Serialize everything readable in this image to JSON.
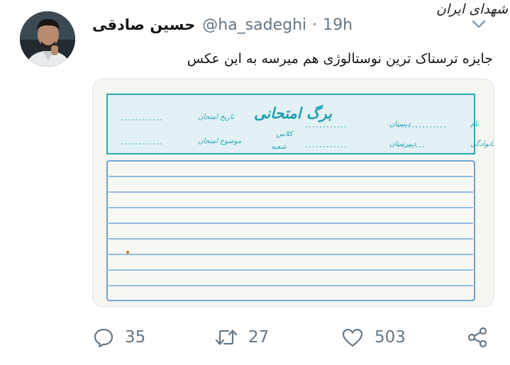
{
  "tweet": {
    "author_name": "حسین صادقی",
    "handle": "@ha_sadeghi",
    "separator": "·",
    "time": "19h",
    "text": "جایزه ترسناک ترین نوستالوژی هم میرسه به این عکس"
  },
  "watermark": "شهدای ایران",
  "media": {
    "title": "برگ امتحانی",
    "fields_right": [
      "نام",
      "نام خانوادگی"
    ],
    "fields_middle": [
      "دبستان",
      "دبیرستان"
    ],
    "fields_center": [
      "کلاس",
      "شعبه"
    ],
    "fields_left": [
      "تاریخ امتحان",
      "موضوع امتحان"
    ]
  },
  "actions": {
    "reply_count": "35",
    "retweet_count": "27",
    "like_count": "503"
  },
  "icons": [
    "reply-icon",
    "retweet-icon",
    "like-icon",
    "share-icon",
    "chevron-down-icon"
  ],
  "colors": {
    "secondary_text": "#657786",
    "form_ink": "#2aa8b8",
    "form_lines": "#4a8ccc"
  }
}
